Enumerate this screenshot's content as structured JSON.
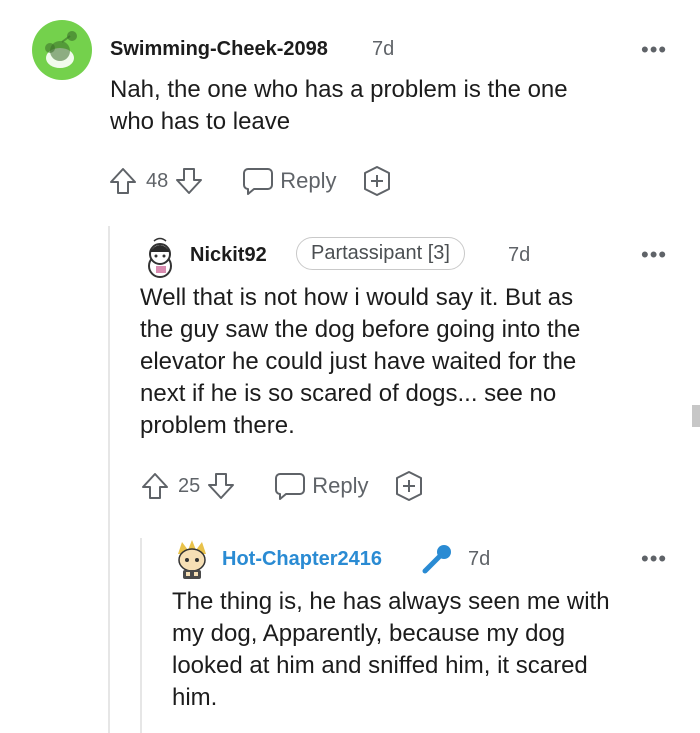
{
  "comments": [
    {
      "username": "Swimming-Cheek-2098",
      "age": "7d",
      "text_lines": [
        "Nah, the one who has a problem is the one",
        "who has to leave"
      ],
      "score": "48",
      "reply_label": "Reply"
    },
    {
      "username": "Nickit92",
      "flair": "Partassipant [3]",
      "age": "7d",
      "text_lines": [
        "Well that is not how i would say it. But as",
        "the guy saw the dog before going into the",
        "elevator he could just have waited for the",
        "next if he is so scared of dogs... see no",
        "problem there."
      ],
      "score": "25",
      "reply_label": "Reply"
    },
    {
      "username": "Hot-Chapter2416",
      "age": "7d",
      "text_lines": [
        "The thing is, he has always seen me with",
        "my dog, Apparently, because my dog",
        "looked at him and sniffed him, it scared",
        "him."
      ]
    }
  ],
  "more_label": "•••",
  "colors": {
    "op_username": "#2a8bd3",
    "avatar_green": "#74d14c",
    "muted": "#5f6368"
  }
}
